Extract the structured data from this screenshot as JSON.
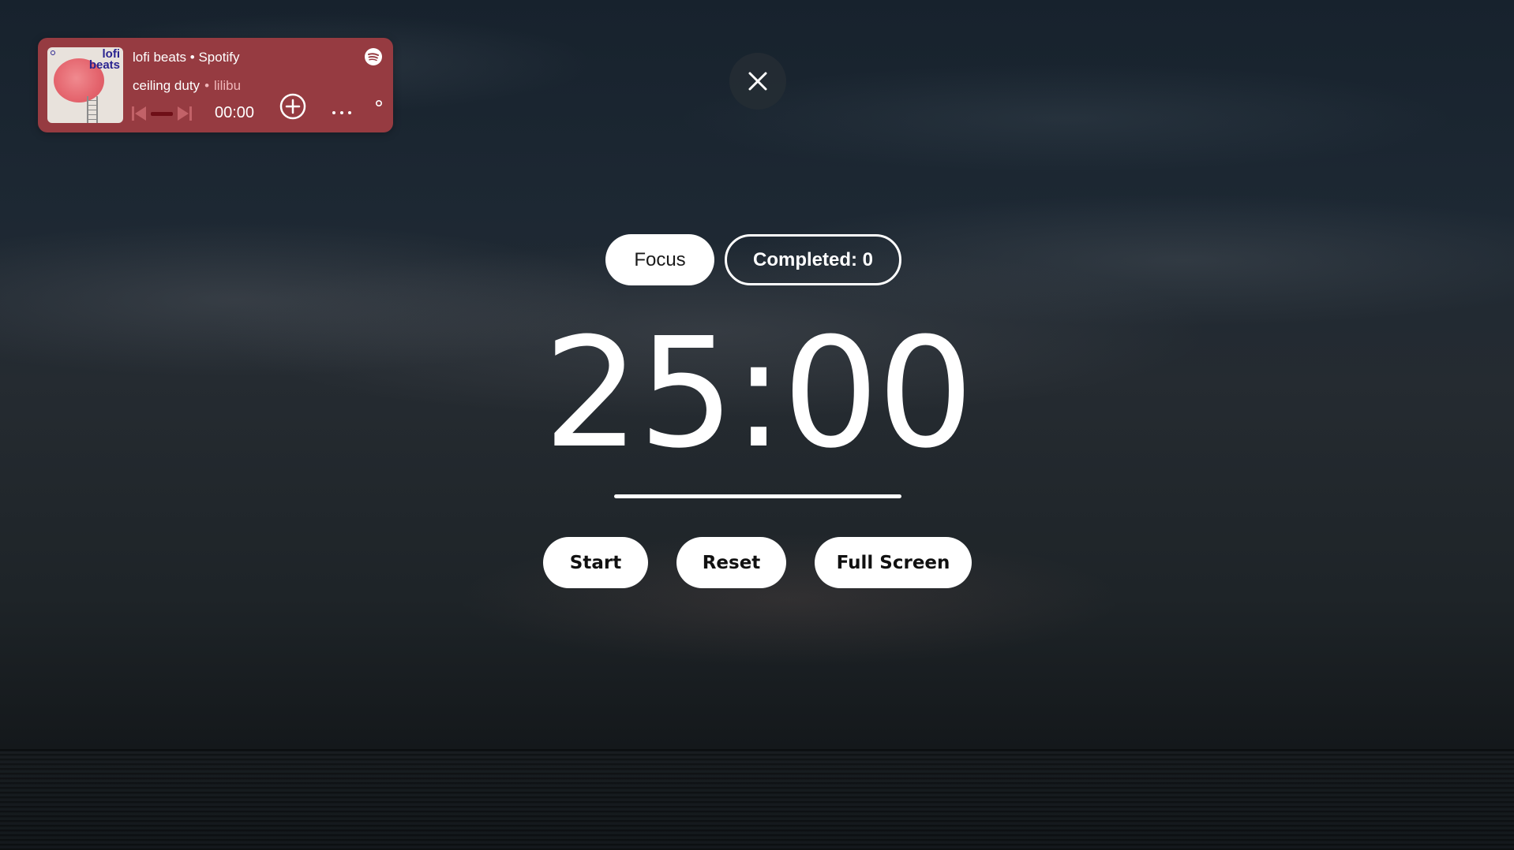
{
  "player": {
    "cover_title": "lofi\nbeats",
    "playlist": "lofi beats",
    "separator": "•",
    "service": "Spotify",
    "track": "ceiling duty",
    "artist": "lilibu",
    "time": "00:00",
    "progress_fraction": 0,
    "background_color": "#963b41",
    "icons": [
      "spotify-icon",
      "previous-track-icon",
      "next-track-icon",
      "add-circle-icon",
      "more-options-icon",
      "small-dot-icon"
    ]
  },
  "close": {
    "icon": "close-icon"
  },
  "mode": {
    "focus_label": "Focus",
    "completed_label": "Completed: 0"
  },
  "timer": {
    "display": "25:00"
  },
  "actions": {
    "start_label": "Start",
    "reset_label": "Reset",
    "fullscreen_label": "Full Screen"
  }
}
